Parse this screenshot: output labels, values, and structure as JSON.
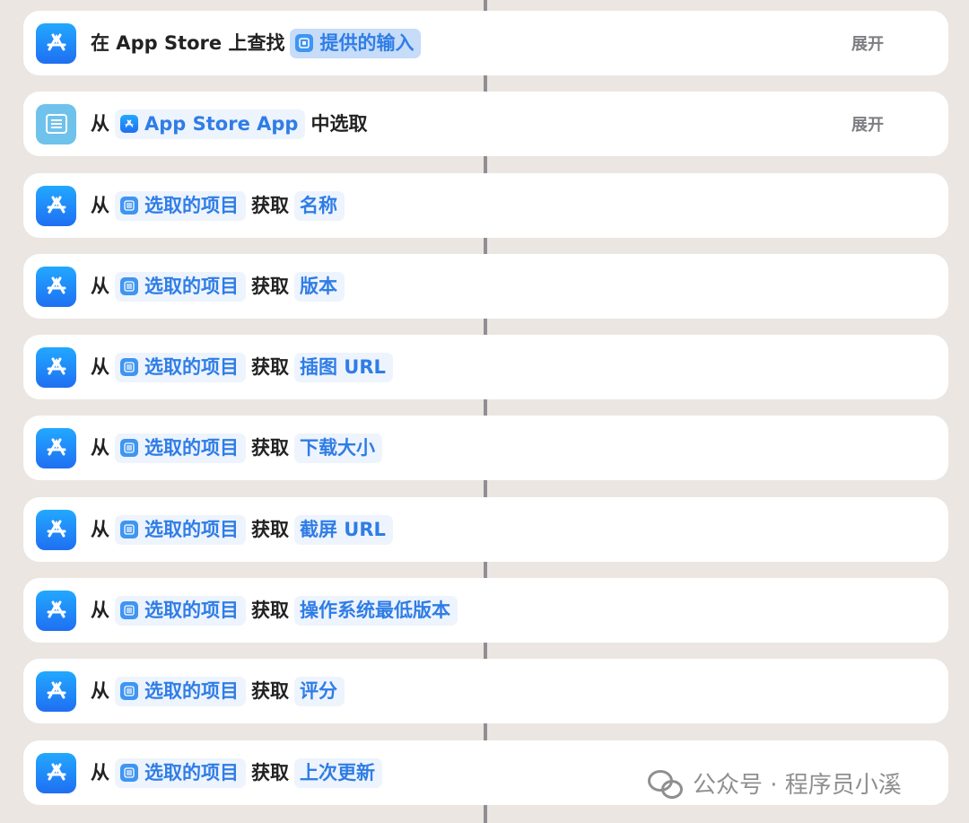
{
  "steps": [
    {
      "icon": "app-store-icon",
      "prefix": "在 App Store 上查找",
      "token": {
        "label": "提供的输入",
        "icon": "input-icon",
        "type": "input"
      },
      "expand_label": "展开"
    },
    {
      "icon": "list-icon",
      "prefix": "从",
      "token": {
        "label": "App Store App",
        "icon": "app-store-icon",
        "type": "nav"
      },
      "suffix": "中选取",
      "expand_label": "展开"
    },
    {
      "icon": "app-store-icon",
      "prefix": "从",
      "source_token": "选取的项目",
      "verb": "获取",
      "property": "名称"
    },
    {
      "icon": "app-store-icon",
      "prefix": "从",
      "source_token": "选取的项目",
      "verb": "获取",
      "property": "版本"
    },
    {
      "icon": "app-store-icon",
      "prefix": "从",
      "source_token": "选取的项目",
      "verb": "获取",
      "property": "插图 URL"
    },
    {
      "icon": "app-store-icon",
      "prefix": "从",
      "source_token": "选取的项目",
      "verb": "获取",
      "property": "下载大小"
    },
    {
      "icon": "app-store-icon",
      "prefix": "从",
      "source_token": "选取的项目",
      "verb": "获取",
      "property": "截屏 URL"
    },
    {
      "icon": "app-store-icon",
      "prefix": "从",
      "source_token": "选取的项目",
      "verb": "获取",
      "property": "操作系统最低版本"
    },
    {
      "icon": "app-store-icon",
      "prefix": "从",
      "source_token": "选取的项目",
      "verb": "获取",
      "property": "评分"
    },
    {
      "icon": "app-store-icon",
      "prefix": "从",
      "source_token": "选取的项目",
      "verb": "获取",
      "property": "上次更新"
    }
  ],
  "watermark": {
    "text": "公众号 · 程序员小溪",
    "icon": "wechat-icon"
  }
}
